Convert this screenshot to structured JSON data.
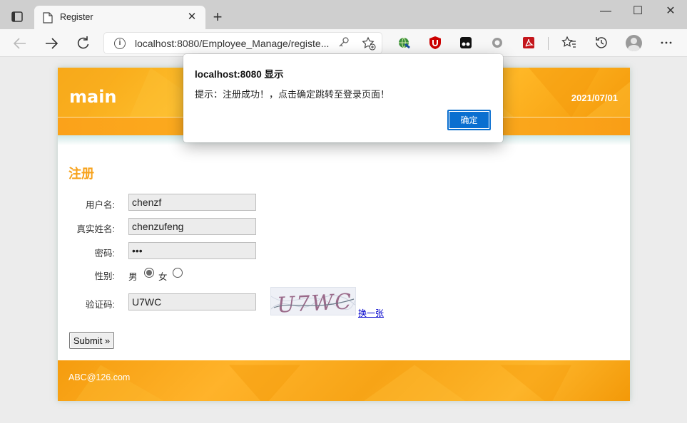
{
  "browser": {
    "tab_title": "Register",
    "tab_close": "✕",
    "new_tab": "+",
    "url": "localhost:8080/Employee_Manage/registe...",
    "window_controls": {
      "minimize": "—",
      "maximize": "☐",
      "close": "✕"
    }
  },
  "page": {
    "site_title": "main",
    "date": "2021/07/01",
    "section_title": "注册",
    "form": {
      "username_label": "用户名:",
      "username_value": "chenzf",
      "realname_label": "真实姓名:",
      "realname_value": "chenzufeng",
      "password_label": "密码:",
      "password_value": "•••",
      "gender_label": "性别:",
      "gender_male": "男",
      "gender_female": "女",
      "gender_selected": "男",
      "captcha_label": "验证码:",
      "captcha_value": "U7WC",
      "captcha_image_text": "U7WC",
      "captcha_refresh": "换一张",
      "submit_label": "Submit »"
    },
    "footer_email": "ABC@126.com"
  },
  "dialog": {
    "title": "localhost:8080 显示",
    "message": "提示：注册成功！，点击确定跳转至登录页面！",
    "ok_label": "确定"
  },
  "colors": {
    "accent_orange": "#f7a21b",
    "dialog_button": "#0a6fd0"
  }
}
